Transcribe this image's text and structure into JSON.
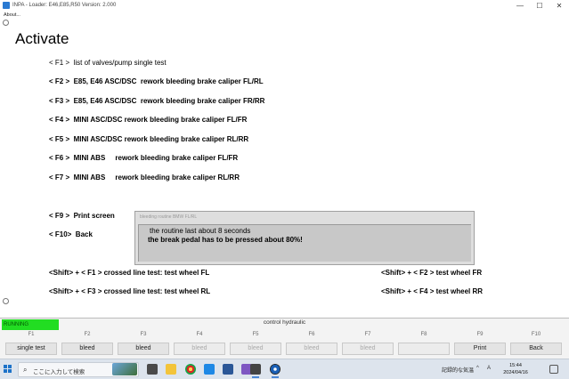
{
  "window": {
    "title": "INPA - Loader:  E46,E85,R50 Version: 2.000",
    "minimize": "—",
    "maximize": "☐",
    "close": "✕"
  },
  "menu": {
    "about": "About..."
  },
  "heading": "Activate",
  "commands": [
    "< F1 >  list of valves/pump single test",
    "< F2 >  E85, E46 ASC/DSC  rework bleeding brake caliper FL/RL",
    "< F3 >  E85, E46 ASC/DSC  rework bleeding brake caliper FR/RR",
    "< F4 >  MINI ASC/DSC rework bleeding brake caliper FL/FR",
    "< F5 >  MINI ASC/DSC rework bleeding brake caliper RL/RR",
    "< F6 >  MINI ABS     rework bleeding brake caliper FL/FR",
    "< F7 >  MINI ABS     rework bleeding brake caliper RL/RR"
  ],
  "print_cmd": "< F9 >  Print screen",
  "back_cmd": "< F10>  Back",
  "shift_commands": {
    "f1": "<Shift> + < F1 > crossed line test: test wheel FL",
    "f2": "<Shift> + < F2 > test wheel FR",
    "f3": "<Shift> + < F3 > crossed line test: test wheel RL",
    "f4": "<Shift> + < F4 > test wheel RR"
  },
  "message_box": {
    "title": "bleeding routine BMW FL/RL",
    "line1": "the routine last about 8 seconds",
    "line2": "the break pedal has to be pressed about 80%!"
  },
  "status": {
    "running": "RUNNING",
    "text": "control hydraulic",
    "running_color": "#22dd22"
  },
  "fkeys": [
    {
      "key": "F1",
      "label": "single test",
      "enabled": true
    },
    {
      "key": "F2",
      "label": "bleed",
      "enabled": true
    },
    {
      "key": "F3",
      "label": "bleed",
      "enabled": true
    },
    {
      "key": "F4",
      "label": "bleed",
      "enabled": false
    },
    {
      "key": "F5",
      "label": "bleed",
      "enabled": false
    },
    {
      "key": "F6",
      "label": "bleed",
      "enabled": false
    },
    {
      "key": "F7",
      "label": "bleed",
      "enabled": false
    },
    {
      "key": "F8",
      "label": "",
      "enabled": false
    },
    {
      "key": "F9",
      "label": "Print",
      "enabled": true
    },
    {
      "key": "F10",
      "label": "Back",
      "enabled": true
    }
  ],
  "taskbar": {
    "search_placeholder": "ここに入力して検索",
    "weather": "記録的な気温",
    "time": "15:44",
    "date": "2024/04/16",
    "ime": "A"
  }
}
